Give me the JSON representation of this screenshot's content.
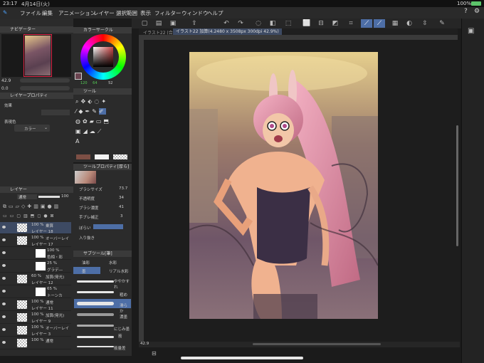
{
  "status": {
    "time": "23:17",
    "date": "4月14日(火)",
    "battery": "100%"
  },
  "menu": [
    "ファイル",
    "編集",
    "アニメーション",
    "レイヤー",
    "選択範囲",
    "表示",
    "フィルター",
    "ウィンドウ",
    "ヘルプ"
  ],
  "navigator": {
    "title": "ナビゲーター",
    "zoom": "42.9",
    "rotation": "0.0"
  },
  "color_circle": {
    "title": "カラーサークル",
    "h": "120",
    "s": "64",
    "v": "52"
  },
  "layer_property": {
    "title": "レイヤープロパティ",
    "effect": "効果",
    "expression": "表現色",
    "color_mode": "カラー"
  },
  "tool": {
    "title": "ツール"
  },
  "tool_property": {
    "title": "ツールプロパティ[厚ら]"
  },
  "brush_props": [
    {
      "label": "ブラシサイズ",
      "value": "73.7"
    },
    {
      "label": "不透明度",
      "value": "34"
    },
    {
      "label": "ブラシ濃度",
      "value": "41"
    },
    {
      "label": "手ブレ補正",
      "value": "3"
    },
    {
      "label": "ぼらい",
      "value": ""
    },
    {
      "label": "入り抜き",
      "value": ""
    }
  ],
  "layers_panel": {
    "title": "レイヤー",
    "blend": "通常",
    "opacity": "100"
  },
  "layers": [
    {
      "opacity": "100 %",
      "mode": "乗算",
      "name": "レイヤー 18",
      "selected": true
    },
    {
      "opacity": "100 %",
      "mode": "オーバーレイ",
      "name": "レイヤー 17",
      "selected": false
    },
    {
      "opacity": "100 %",
      "mode": "加算(発光)",
      "name": "色相・彩",
      "selected": false
    },
    {
      "opacity": "25 %",
      "mode": "通常",
      "name": "グラデ―",
      "selected": false
    },
    {
      "opacity": "60 %",
      "mode": "加算(発光)",
      "name": "レイヤー 12",
      "selected": false
    },
    {
      "opacity": "65 %",
      "mode": "通常",
      "name": "トーンカ",
      "selected": false
    },
    {
      "opacity": "100 %",
      "mode": "通常",
      "name": "レイヤー 11",
      "selected": false
    },
    {
      "opacity": "100 %",
      "mode": "加算(発光)",
      "name": "レイヤー 9",
      "selected": false
    },
    {
      "opacity": "100 %",
      "mode": "オーバーレイ",
      "name": "レイヤー 3",
      "selected": false
    },
    {
      "opacity": "100 %",
      "mode": "通常",
      "name": "",
      "selected": false
    }
  ],
  "subtool": {
    "title": "サブツール[筆]",
    "groups": [
      "油彩",
      "水彩",
      "墨",
      "リアル水彩"
    ],
    "brushes": [
      "ややかすれ",
      "粗め",
      "滑らか",
      "濃墨",
      "にじみ墨",
      "筋",
      "鉄線",
      "筋量差"
    ]
  },
  "document": {
    "tab": "イラスト22 (合成)",
    "info": "イラスト22 加算(4.2480 x 3508px 300dpi 42.9%)"
  },
  "zoom_readout": "42.9",
  "colors": {
    "accent": "#4d6ea6",
    "panel": "#2b2b2b",
    "canvasbg": "#1d1d1d"
  }
}
